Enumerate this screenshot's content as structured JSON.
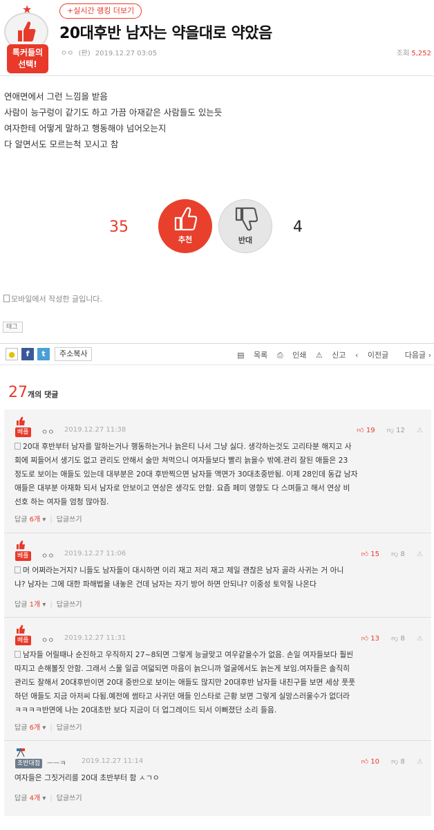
{
  "header": {
    "badge_label_line1": "톡커들의",
    "badge_label_line2": "선택!",
    "ranking_button": "+실시간 랭킹 더보기",
    "title": "20대후반 남자는 약을대로 약았음",
    "author": "ㅇㅇ",
    "author_tag": "(판)",
    "date": "2019.12.27 03:05",
    "views_label": "조회",
    "views_value": "5,252"
  },
  "post": {
    "lines": [
      "연애면에서 그런 느낌을 받음",
      "사람이 능구렁이 같기도 하고 가끔 아재같은 사람들도 있는듯",
      "여자한테 어떻게 말하고 행동해야 넘어오는지",
      "다 알면서도 모르는척 꼬시고 참"
    ]
  },
  "votes": {
    "up_count": "35",
    "up_label": "추천",
    "down_count": "4",
    "down_label": "반대"
  },
  "mobile_note": "모바일에서 작성한 글입니다.",
  "tag_label": "태그",
  "toolbar": {
    "copy_url": "주소복사",
    "list": "목록",
    "print": "인쇄",
    "report": "신고",
    "prev": "이전글",
    "next": "다음글"
  },
  "comments_header": {
    "count": "27",
    "label": "개의 댓글"
  },
  "comments": [
    {
      "rank": "베플",
      "author": "ㅇㅇ",
      "date": "2019.12.27 11:38",
      "up": "19",
      "down": "12",
      "lines": [
        "20대 후반부터 남자를 말하는거나 행동하는거나 늙은티 나서 그냥 싫다. 생각하는것도 고리타분 해지고 사",
        "회에 찌들어서 생기도 없고 관리도 안해서 술만 쳐먹으니 여자들보다 빨리 늙을수 밖에.관리 잘된 애들은 23",
        "정도로 보이는 애들도 있는데 대부분은 20대 후반찍으면 남자들 액면가 30대초중반됨. 이제 28인데 동갑 남자",
        "애들은 대부분 아재화 되서 남자로 안보이고 연상은 생각도 안함. 요즘 페미 영향도 다 스며들고 해서 연상 비",
        "선호 하는 여자들 엄청 많아짐."
      ],
      "reply_label": "답글",
      "reply_count": "6개",
      "reply_write": "답글쓰기"
    },
    {
      "rank": "베플",
      "author": "ㅇㅇ",
      "date": "2019.12.27 11:06",
      "up": "15",
      "down": "8",
      "lines": [
        "머 어쩌라는거지? 니들도 남자들이 대시하면 이리 재고 저리 재고 제일 괜찮은 남자 골라 사귀는 거 아니",
        "냐? 남자는 그에 대한 파해법을 내놓은 건데 남자는 자기 방어 하면 안되냐? 이중성 토악질 나온다"
      ],
      "reply_label": "답글",
      "reply_count": "1개",
      "reply_write": "답글쓰기"
    },
    {
      "rank": "베플",
      "author": "ㅇㅇ",
      "date": "2019.12.27 11:31",
      "up": "13",
      "down": "8",
      "lines": [
        "남자들 어릴때나 순진하고 우직하지 27~8되면 그렇게 능글맞고 여우같을수가 없음. 손일 여자들보다 훨씬",
        "따지고 손해볼짓 안함. 그래서 스물 일곱 여덟되면 마음이 늙으니까 얼굴에서도 늙는게 보임.여자들은 솔직히",
        "관리도 잘해서 20대후반이면 20대 중반으로 보이는 애들도 많지만 20대후반 남자들 내친구들 보면 세상 풋풋",
        "하던 애들도 지금 아저씨 다됨.예전에 썸타고 사귀던 애들 인스타로 근황 보면 그렇게 실망스러울수가 없더라",
        "ㅋㅋㅋㅋ반면에 나는 20대초반 보다 지금이 더 업그레이드 되서 이뻐졌단 소리 들음."
      ],
      "reply_label": "답글",
      "reply_count": "6개",
      "reply_write": "답글쓰기"
    },
    {
      "rank": "초반대첩",
      "author": "ㅡㅡㅋ",
      "date": "2019.12.27 11:14",
      "up": "10",
      "down": "8",
      "lines": [
        "여자들은 그짓거리를 20대 초반부터 함 ㅅㄱㅇ"
      ],
      "reply_label": "답글",
      "reply_count": "4개",
      "reply_write": "답글쓰기"
    }
  ]
}
